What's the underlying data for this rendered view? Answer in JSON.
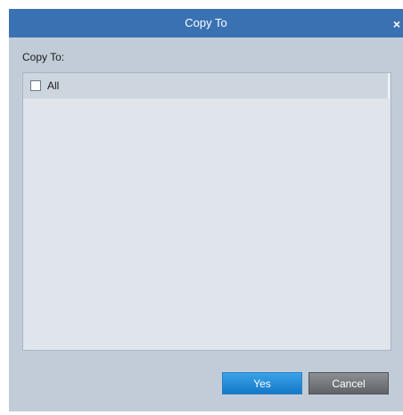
{
  "dialog": {
    "title": "Copy To",
    "close_glyph": "×"
  },
  "section": {
    "label": "Copy To:"
  },
  "list": {
    "items": [
      {
        "label": "All",
        "checked": false
      }
    ]
  },
  "buttons": {
    "yes_label": "Yes",
    "cancel_label": "Cancel"
  },
  "colors": {
    "titlebar": "#3a71b3",
    "dialog_bg": "#c2ccd8",
    "list_bg": "#dfe5eb",
    "yes_button": "#1f8ad6",
    "cancel_button": "#6e7276"
  },
  "icons": {
    "close": "close-icon"
  }
}
